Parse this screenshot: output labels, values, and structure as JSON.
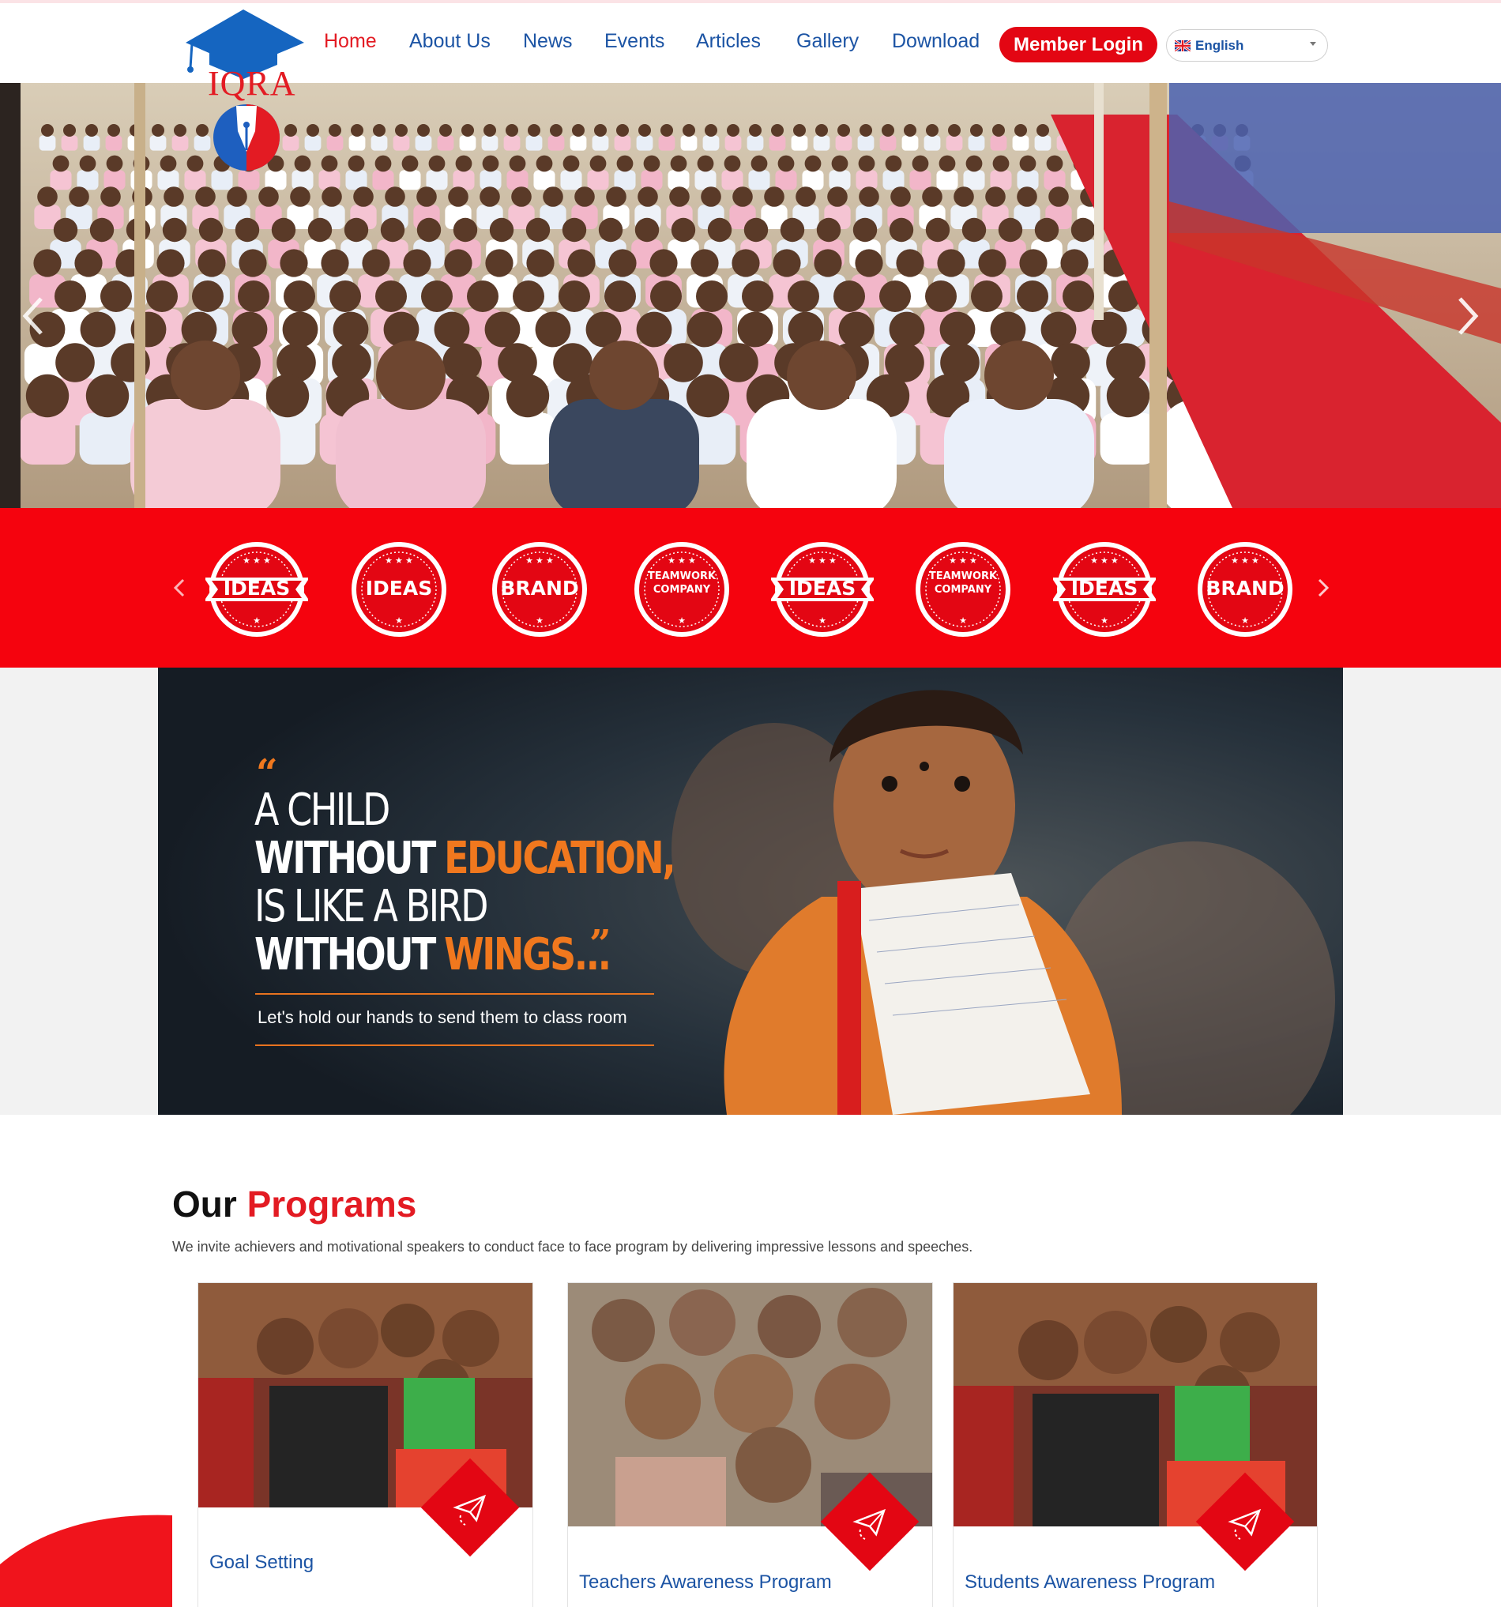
{
  "brand": {
    "name": "IQRA",
    "primary_color": "#e31b23",
    "nav_color": "#1c54a4"
  },
  "nav": {
    "items": [
      {
        "label": "Home",
        "active": true
      },
      {
        "label": "About Us",
        "active": false
      },
      {
        "label": "News",
        "active": false
      },
      {
        "label": "Events",
        "active": false
      },
      {
        "label": "Articles",
        "active": false
      },
      {
        "label": "Gallery",
        "active": false
      },
      {
        "label": "Download",
        "active": false
      }
    ],
    "login_label": "Member Login",
    "language": {
      "selected": "English",
      "icon": "uk-flag-icon"
    }
  },
  "hero": {
    "prev_icon": "chevron-left-icon",
    "next_icon": "chevron-right-icon"
  },
  "badges": {
    "prev_icon": "chevron-left-icon",
    "next_icon": "chevron-right-icon",
    "items": [
      {
        "text": "IDEAS"
      },
      {
        "text": "IDEAS"
      },
      {
        "text": "BRAND"
      },
      {
        "text": "TEAMWORK COMPANY"
      },
      {
        "text": "IDEAS"
      },
      {
        "text": "TEAMWORK COMPANY"
      },
      {
        "text": "IDEAS"
      },
      {
        "text": "BRAND"
      }
    ]
  },
  "quote": {
    "line1": "A CHILD",
    "line2_a": "WITHOUT",
    "line2_b": "EDUCATION,",
    "line3": "IS LIKE A BIRD",
    "line4_a": "WITHOUT",
    "line4_b": "WINGS...",
    "subtitle": "Let's hold our hands to send them to class room",
    "accent": "#f0781e"
  },
  "programs": {
    "title_a": "Our",
    "title_b": "Programs",
    "description": "We invite achievers and motivational speakers to conduct face to face program by delivering impressive lessons and speeches.",
    "cards": [
      {
        "title": "Goal Setting",
        "icon": "paper-plane-icon"
      },
      {
        "title": "Teachers Awareness Program",
        "icon": "paper-plane-icon"
      },
      {
        "title": "Students Awareness Program",
        "icon": "paper-plane-icon"
      }
    ]
  }
}
